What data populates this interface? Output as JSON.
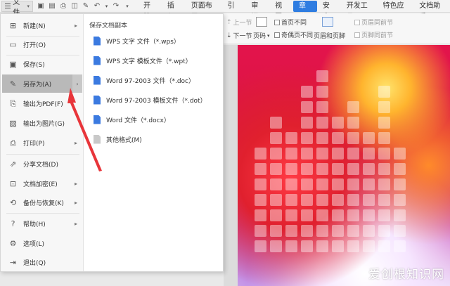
{
  "topbar": {
    "file_label": "文件",
    "tabs": [
      "开始",
      "插入",
      "页面布局",
      "引用",
      "审阅",
      "视图",
      "章节",
      "安全",
      "开发工具",
      "特色应用",
      "文档助手"
    ],
    "active_tab": "章节",
    "accent": "#2f7de1"
  },
  "ribbon": {
    "prev_section": "上一节",
    "next_section": "下一节",
    "page_number": "页码",
    "first_page_diff": "首页不同",
    "odd_even_diff": "奇偶页不同",
    "header_footer": "页眉和页脚",
    "link_prev_header": "页眉同前节",
    "link_prev_footer": "页脚同前节"
  },
  "menu": {
    "items": [
      {
        "label": "新建(N)",
        "icon": "new-icon",
        "arrow": true
      },
      {
        "label": "打开(O)",
        "icon": "folder-icon",
        "arrow": false
      },
      {
        "label": "保存(S)",
        "icon": "save-icon",
        "arrow": false
      },
      {
        "label": "另存为(A)",
        "icon": "save-as-icon",
        "arrow": true,
        "active": true
      },
      {
        "label": "输出为PDF(F)",
        "icon": "pdf-icon",
        "arrow": false
      },
      {
        "label": "输出为图片(G)",
        "icon": "image-icon",
        "arrow": false
      },
      {
        "label": "打印(P)",
        "icon": "print-icon",
        "arrow": true
      },
      {
        "label": "分享文档(D)",
        "icon": "share-icon",
        "arrow": false
      },
      {
        "label": "文档加密(E)",
        "icon": "encrypt-icon",
        "arrow": true
      },
      {
        "label": "备份与恢复(K)",
        "icon": "backup-icon",
        "arrow": true
      },
      {
        "label": "帮助(H)",
        "icon": "help-icon",
        "arrow": true
      },
      {
        "label": "选项(L)",
        "icon": "gear-icon",
        "arrow": false
      },
      {
        "label": "退出(Q)",
        "icon": "exit-icon",
        "arrow": false
      }
    ],
    "submenu_title": "保存文档副本",
    "submenu_items": [
      {
        "label": "WPS 文字 文件（*.wps）",
        "icon": "doc-icon"
      },
      {
        "label": "WPS 文字 模板文件（*.wpt）",
        "icon": "doc-icon"
      },
      {
        "label": "Word 97-2003 文件（*.doc）",
        "icon": "doc-icon"
      },
      {
        "label": "Word 97-2003 模板文件（*.dot）",
        "icon": "doc-icon"
      },
      {
        "label": "Word 文件（*.docx）",
        "icon": "doc-icon"
      },
      {
        "label": "其他格式(M)",
        "icon": "other-format-icon"
      }
    ],
    "highlight_color": "#b9b9b9"
  },
  "annotation_color": "#e8353a",
  "watermark": "爱创根知识网"
}
